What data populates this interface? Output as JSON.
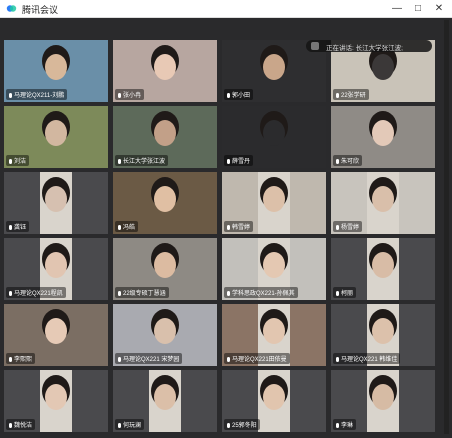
{
  "window": {
    "title": "腾讯会议",
    "minimize": "—",
    "maximize": "□",
    "close": "✕"
  },
  "speaking": {
    "text": "正在讲话: 长江大学张江波;"
  },
  "tiles": [
    {
      "label": "马理论QX211-刘鹏"
    },
    {
      "label": "张小冉"
    },
    {
      "label": "郭小田"
    },
    {
      "label": "22张学研"
    },
    {
      "label": "刘洁"
    },
    {
      "label": "长江大学张江波"
    },
    {
      "label": "薛雪丹"
    },
    {
      "label": "朱可欣"
    },
    {
      "label": "龚钰"
    },
    {
      "label": "冯皓"
    },
    {
      "label": "韩雪婷"
    },
    {
      "label": "杨雪婷"
    },
    {
      "label": "马理论QX221程凯"
    },
    {
      "label": "22级专硕丁慧涵"
    },
    {
      "label": "学科思政QX221-孙佩其"
    },
    {
      "label": "柯丽"
    },
    {
      "label": "李熙熙"
    },
    {
      "label": "马理论QX221 宋梦园"
    },
    {
      "label": "马理论QX221田依曼"
    },
    {
      "label": "马理论QX221 韩维佳"
    },
    {
      "label": "魏悦洁"
    },
    {
      "label": "何玩澜"
    },
    {
      "label": "25郭冬阳"
    },
    {
      "label": "李琳"
    }
  ]
}
